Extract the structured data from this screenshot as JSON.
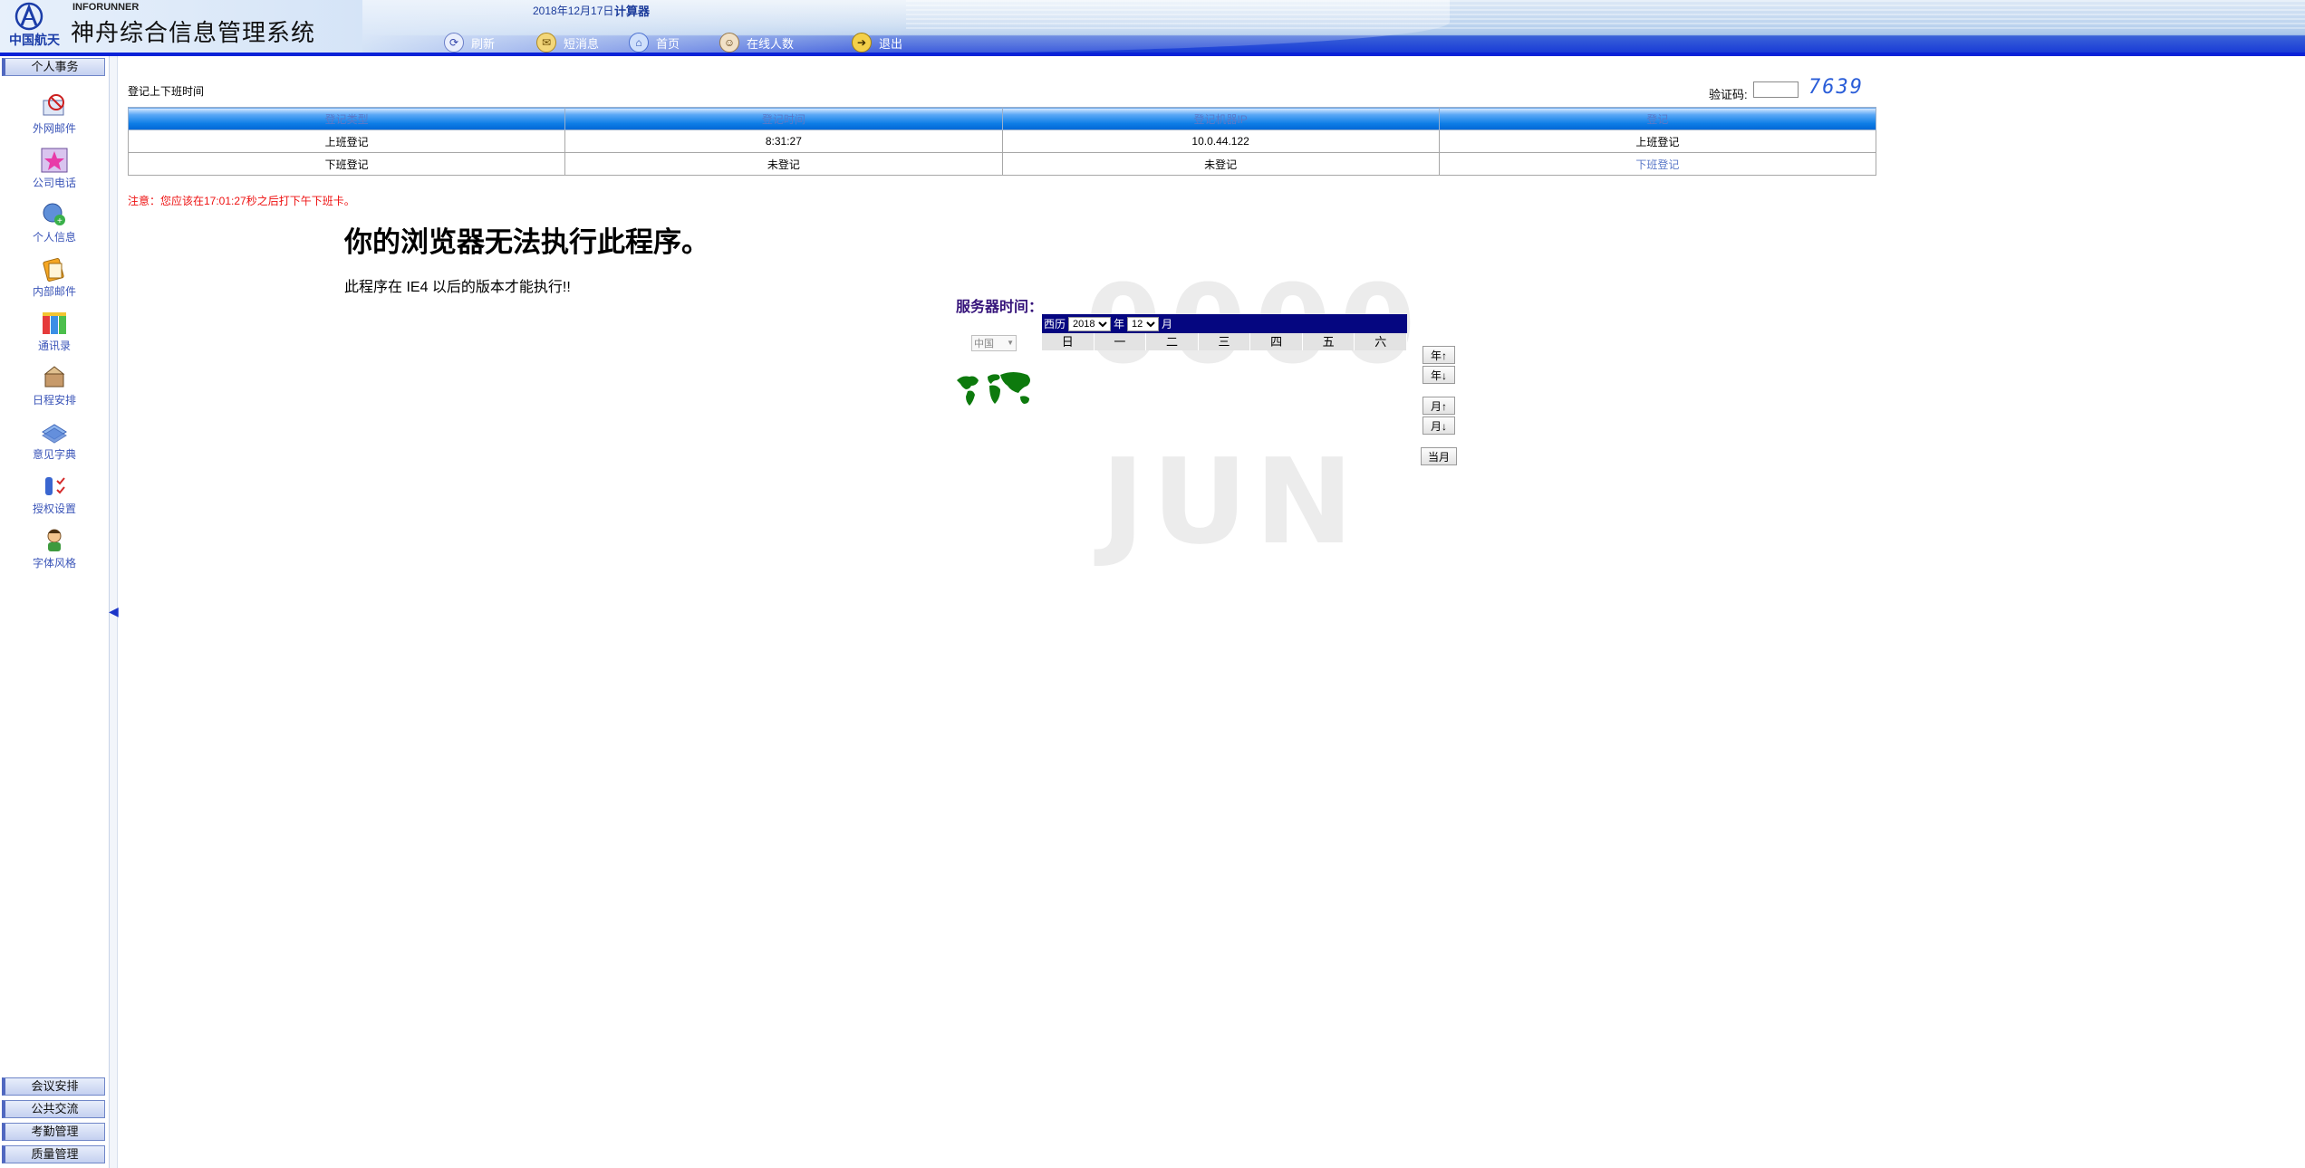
{
  "header": {
    "logo_text": "中国航天",
    "brand_en": "INFORUNNER",
    "title": "神舟综合信息管理系统",
    "date": "2018年12月17日",
    "calculator": "计算器",
    "nav": [
      {
        "label": "刷新",
        "icon": "refresh-icon"
      },
      {
        "label": "短消息",
        "icon": "message-icon"
      },
      {
        "label": "首页",
        "icon": "home-icon"
      },
      {
        "label": "在线人数",
        "icon": "online-users-icon"
      },
      {
        "label": "退出",
        "icon": "exit-icon"
      }
    ]
  },
  "sidebar": {
    "group_title": "个人事务",
    "items": [
      {
        "label": "外网邮件",
        "icon": "external-mail-icon"
      },
      {
        "label": "公司电话",
        "icon": "company-phone-icon"
      },
      {
        "label": "个人信息",
        "icon": "personal-info-icon"
      },
      {
        "label": "内部邮件",
        "icon": "internal-mail-icon"
      },
      {
        "label": "通讯录",
        "icon": "address-book-icon"
      },
      {
        "label": "日程安排",
        "icon": "schedule-icon"
      },
      {
        "label": "意见字典",
        "icon": "opinion-dictionary-icon"
      },
      {
        "label": "授权设置",
        "icon": "authorization-settings-icon"
      },
      {
        "label": "字体风格",
        "icon": "font-style-icon"
      }
    ],
    "bottom_groups": [
      "会议安排",
      "公共交流",
      "考勤管理",
      "质量管理"
    ]
  },
  "main": {
    "section_title": "登记上下班时间",
    "captcha_label": "验证码:",
    "captcha_value": "",
    "captcha_code": "7639",
    "table": {
      "headers": [
        "登记类型",
        "登记时间",
        "登记机器IP",
        "登记"
      ],
      "rows": [
        {
          "type": "上班登记",
          "time": "8:31:27",
          "ip": "10.0.44.122",
          "action": "上班登记",
          "action_link": false
        },
        {
          "type": "下班登记",
          "time": "未登记",
          "ip": "未登记",
          "action": "下班登记",
          "action_link": true
        }
      ]
    },
    "notice": "注意：您应该在17:01:27秒之后打下午下班卡。",
    "error_heading": "你的浏览器无法执行此程序。",
    "error_text": "此程序在 IE4 以后的版本才能执行!!"
  },
  "clock": {
    "server_time_label": "服务器时间：",
    "region_selected": "中国",
    "watermark_year": "0000",
    "watermark_month": "JUN"
  },
  "calendar": {
    "calendar_type": "西历",
    "year_selected": "2018",
    "year_unit": "年",
    "month_selected": "12",
    "month_unit": "月",
    "weekdays": [
      "日",
      "一",
      "二",
      "三",
      "四",
      "五",
      "六"
    ],
    "buttons": {
      "year_up": "年↑",
      "year_down": "年↓",
      "month_up": "月↑",
      "month_down": "月↓",
      "current_month": "当月"
    }
  }
}
